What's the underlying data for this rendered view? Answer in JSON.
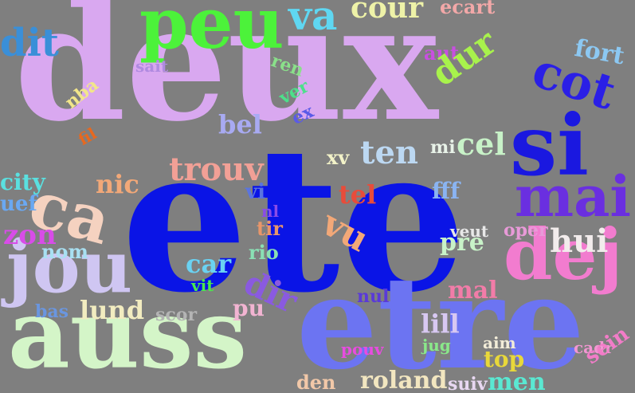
{
  "background": "#7f7f7f",
  "words": [
    {
      "text": "ete",
      "color": "#0a14e6",
      "rotated": false
    },
    {
      "text": "deux",
      "color": "#d9a8f0",
      "rotated": false
    },
    {
      "text": "etre",
      "color": "#6c74f2",
      "rotated": false
    },
    {
      "text": "auss",
      "color": "#d4f5c8",
      "rotated": false
    },
    {
      "text": "si",
      "color": "#1a18e0",
      "rotated": false
    },
    {
      "text": "peu",
      "color": "#4cf23a",
      "rotated": false
    },
    {
      "text": "jou",
      "color": "#cfc6f2",
      "rotated": false
    },
    {
      "text": "dej",
      "color": "#f27ccf",
      "rotated": false
    },
    {
      "text": "ca",
      "color": "#f5d2c0",
      "rotated": true
    },
    {
      "text": "mai",
      "color": "#6a2fe0",
      "rotated": false
    },
    {
      "text": "cot",
      "color": "#2a1fe6",
      "rotated": true
    },
    {
      "text": "va",
      "color": "#5fd7f2",
      "rotated": false
    },
    {
      "text": "dit",
      "color": "#3a8fd8",
      "rotated": false
    },
    {
      "text": "cour",
      "color": "#eef2a8",
      "rotated": false
    },
    {
      "text": "ecart",
      "color": "#f2a8a8",
      "rotated": false
    },
    {
      "text": "fort",
      "color": "#8cc8f2",
      "rotated": true
    },
    {
      "text": "aut",
      "color": "#c84fe0",
      "rotated": false
    },
    {
      "text": "sait",
      "color": "#b08ae0",
      "rotated": false
    },
    {
      "text": "ren",
      "color": "#8ae08a",
      "rotated": true
    },
    {
      "text": "dur",
      "color": "#a8f24c",
      "rotated": true
    },
    {
      "text": "ver",
      "color": "#4ce08a",
      "rotated": true
    },
    {
      "text": "ex",
      "color": "#5a5ae8",
      "rotated": true
    },
    {
      "text": "nba",
      "color": "#f2e68a",
      "rotated": true
    },
    {
      "text": "fil",
      "color": "#e8681e",
      "rotated": true
    },
    {
      "text": "bel",
      "color": "#a8aaf2",
      "rotated": false
    },
    {
      "text": "ten",
      "color": "#bcd8f2",
      "rotated": false
    },
    {
      "text": "mi",
      "color": "#e8f2e8",
      "rotated": false
    },
    {
      "text": "cel",
      "color": "#c8f2c8",
      "rotated": false
    },
    {
      "text": "xv",
      "color": "#f2f2c8",
      "rotated": false
    },
    {
      "text": "trouv",
      "color": "#f2a096",
      "rotated": false
    },
    {
      "text": "nic",
      "color": "#f2a878",
      "rotated": false
    },
    {
      "text": "city",
      "color": "#5ae0e0",
      "rotated": false
    },
    {
      "text": "uef",
      "color": "#6aa8f2",
      "rotated": false
    },
    {
      "text": "vi",
      "color": "#5a74e0",
      "rotated": false
    },
    {
      "text": "tel",
      "color": "#e84c3a",
      "rotated": false
    },
    {
      "text": "fff",
      "color": "#8ab4f2",
      "rotated": false
    },
    {
      "text": "nl",
      "color": "#8a4ce8",
      "rotated": false
    },
    {
      "text": "vu",
      "color": "#f2a878",
      "rotated": true
    },
    {
      "text": "tir",
      "color": "#e8966a",
      "rotated": false
    },
    {
      "text": "zon",
      "color": "#d84ce8",
      "rotated": false
    },
    {
      "text": "nom",
      "color": "#a8e0f2",
      "rotated": false
    },
    {
      "text": "rio",
      "color": "#8ae0b4",
      "rotated": false
    },
    {
      "text": "car",
      "color": "#6ad2f2",
      "rotated": false
    },
    {
      "text": "veut",
      "color": "#e8e8e8",
      "rotated": false
    },
    {
      "text": "oper",
      "color": "#e89ad8",
      "rotated": false
    },
    {
      "text": "pre",
      "color": "#c8f2c8",
      "rotated": false
    },
    {
      "text": "hui",
      "color": "#f2ecec",
      "rotated": false
    },
    {
      "text": "dir",
      "color": "#8a5ae0",
      "rotated": true
    },
    {
      "text": "vit",
      "color": "#4ce84c",
      "rotated": false
    },
    {
      "text": "mal",
      "color": "#f27ca8",
      "rotated": false
    },
    {
      "text": "nul",
      "color": "#5a3ad8",
      "rotated": false
    },
    {
      "text": "lund",
      "color": "#f2ecc0",
      "rotated": false
    },
    {
      "text": "bas",
      "color": "#6a96e0",
      "rotated": false
    },
    {
      "text": "scor",
      "color": "#b4b4b4",
      "rotated": false
    },
    {
      "text": "pu",
      "color": "#f2b4d2",
      "rotated": false
    },
    {
      "text": "lill",
      "color": "#d8c8f2",
      "rotated": false
    },
    {
      "text": "pouv",
      "color": "#e84ce0",
      "rotated": false
    },
    {
      "text": "jug",
      "color": "#8ae88a",
      "rotated": false
    },
    {
      "text": "aim",
      "color": "#f2ecd8",
      "rotated": false
    },
    {
      "text": "top",
      "color": "#e8d83a",
      "rotated": false
    },
    {
      "text": "cadr",
      "color": "#f296d2",
      "rotated": false
    },
    {
      "text": "sein",
      "color": "#f27cc8",
      "rotated": true
    },
    {
      "text": "den",
      "color": "#f2c8a8",
      "rotated": false
    },
    {
      "text": "roland",
      "color": "#f2e6c0",
      "rotated": false
    },
    {
      "text": "suiv",
      "color": "#e8d8f2",
      "rotated": false
    },
    {
      "text": "men",
      "color": "#5ae8d2",
      "rotated": false
    }
  ]
}
